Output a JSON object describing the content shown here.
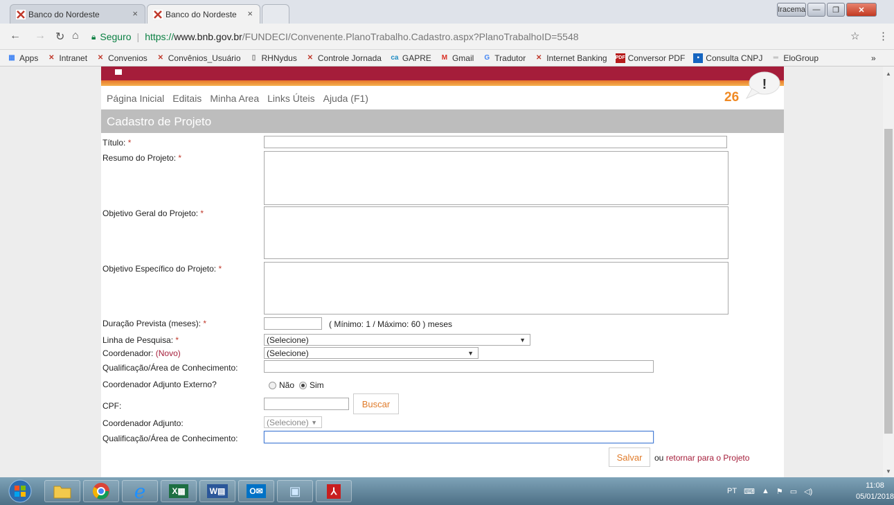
{
  "browser": {
    "tabs": [
      {
        "title": "Banco do Nordeste",
        "active": false
      },
      {
        "title": "Banco do Nordeste",
        "active": true
      }
    ],
    "window_user": "Iracema",
    "url": {
      "security": "Seguro",
      "scheme": "https://",
      "host": "www.bnb.gov.br",
      "path": "/FUNDECI/Convenente.PlanoTrabalho.Cadastro.aspx?PlanoTrabalhoID=5548"
    },
    "bookmarks": [
      "Apps",
      "Intranet",
      "Convenios",
      "Convênios_Usuário",
      "RHNydus",
      "Controle Jornada",
      "GAPRE",
      "Gmail",
      "Tradutor",
      "Internet Banking",
      "Conversor PDF",
      "Consulta CNPJ",
      "EloGroup"
    ]
  },
  "site": {
    "menu": [
      "Página Inicial",
      "Editais",
      "Minha Area",
      "Links Úteis",
      "Ajuda (F1)"
    ],
    "notification_count": "26",
    "notification_symbol": "!"
  },
  "form": {
    "title": "Cadastro de Projeto",
    "required_mark": "*",
    "titulo_label": "Título:",
    "resumo_label": "Resumo do Projeto:",
    "objetivo_geral_label": "Objetivo Geral do Projeto:",
    "objetivo_especifico_label": "Objetivo Específico do Projeto:",
    "duracao_label": "Duração Prevista (meses):",
    "duracao_hint": "( Mínimo: 1 / Máximo: 60 ) meses",
    "linha_label": "Linha de Pesquisa:",
    "linha_value": "(Selecione)",
    "coordenador_label": "Coordenador:",
    "coordenador_novo": "(Novo)",
    "coordenador_value": "(Selecione)",
    "qualificacao_label": "Qualificação/Área de Conhecimento:",
    "adjunto_externo_label": "Coordenador Adjunto Externo?",
    "radio_nao": "Não",
    "radio_sim": "Sim",
    "cpf_label": "CPF:",
    "buscar_label": "Buscar",
    "adjunto_label": "Coordenador Adjunto:",
    "adjunto_value": "(Selecione)",
    "qualificacao2_label": "Qualificação/Área de Conhecimento:",
    "salvar_label": "Salvar",
    "retornar_prefix": "ou",
    "retornar_link": "retornar para o Projeto"
  },
  "taskbar": {
    "language": "PT",
    "time": "11:08",
    "date": "05/01/2018"
  }
}
